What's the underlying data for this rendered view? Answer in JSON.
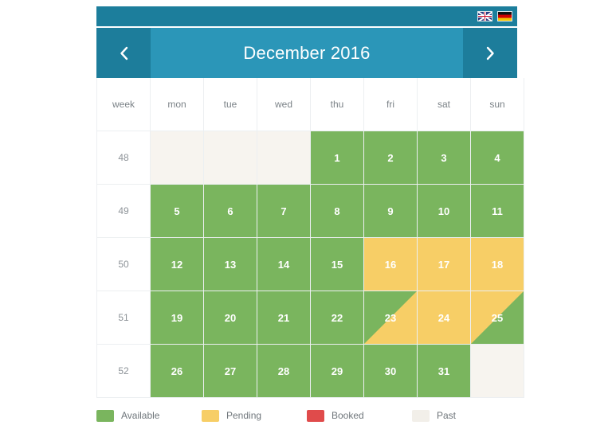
{
  "topbar": {
    "languages": [
      {
        "name": "english-flag",
        "title": "English"
      },
      {
        "name": "german-flag",
        "title": "Deutsch"
      }
    ]
  },
  "header": {
    "prev_label": "‹",
    "next_label": "›",
    "month_title": "December 2016"
  },
  "columns": [
    "week",
    "mon",
    "tue",
    "wed",
    "thu",
    "fri",
    "sat",
    "sun"
  ],
  "weeks": [
    {
      "week": "48",
      "days": [
        {
          "label": "",
          "state": "empty"
        },
        {
          "label": "",
          "state": "empty"
        },
        {
          "label": "",
          "state": "empty"
        },
        {
          "label": "1",
          "state": "available"
        },
        {
          "label": "2",
          "state": "available"
        },
        {
          "label": "3",
          "state": "available"
        },
        {
          "label": "4",
          "state": "available"
        }
      ]
    },
    {
      "week": "49",
      "days": [
        {
          "label": "5",
          "state": "available"
        },
        {
          "label": "6",
          "state": "available"
        },
        {
          "label": "7",
          "state": "available"
        },
        {
          "label": "8",
          "state": "available"
        },
        {
          "label": "9",
          "state": "available"
        },
        {
          "label": "10",
          "state": "available"
        },
        {
          "label": "11",
          "state": "available"
        }
      ]
    },
    {
      "week": "50",
      "days": [
        {
          "label": "12",
          "state": "available"
        },
        {
          "label": "13",
          "state": "available"
        },
        {
          "label": "14",
          "state": "available"
        },
        {
          "label": "15",
          "state": "available"
        },
        {
          "label": "16",
          "state": "pending"
        },
        {
          "label": "17",
          "state": "pending"
        },
        {
          "label": "18",
          "state": "pending"
        }
      ]
    },
    {
      "week": "51",
      "days": [
        {
          "label": "19",
          "state": "available"
        },
        {
          "label": "20",
          "state": "available"
        },
        {
          "label": "21",
          "state": "available"
        },
        {
          "label": "22",
          "state": "available"
        },
        {
          "label": "23",
          "state": "split-green-yellow"
        },
        {
          "label": "24",
          "state": "pending"
        },
        {
          "label": "25",
          "state": "split-yellow-green"
        }
      ]
    },
    {
      "week": "52",
      "days": [
        {
          "label": "26",
          "state": "available"
        },
        {
          "label": "27",
          "state": "available"
        },
        {
          "label": "28",
          "state": "available"
        },
        {
          "label": "29",
          "state": "available"
        },
        {
          "label": "30",
          "state": "available"
        },
        {
          "label": "31",
          "state": "available"
        },
        {
          "label": "",
          "state": "empty"
        }
      ]
    }
  ],
  "legend": [
    {
      "label": "Available",
      "color": "#7ab55e"
    },
    {
      "label": "Pending",
      "color": "#f7ce66"
    },
    {
      "label": "Booked",
      "color": "#e04b4b"
    },
    {
      "label": "Past",
      "color": "#f2efe9"
    }
  ],
  "colors": {
    "topbar": "#1c7e9c",
    "nav_button": "#1d7d9b",
    "header": "#2b96b8",
    "available": "#7ab55e",
    "pending": "#f7ce66",
    "booked": "#e04b4b",
    "past": "#f7f4ef"
  }
}
